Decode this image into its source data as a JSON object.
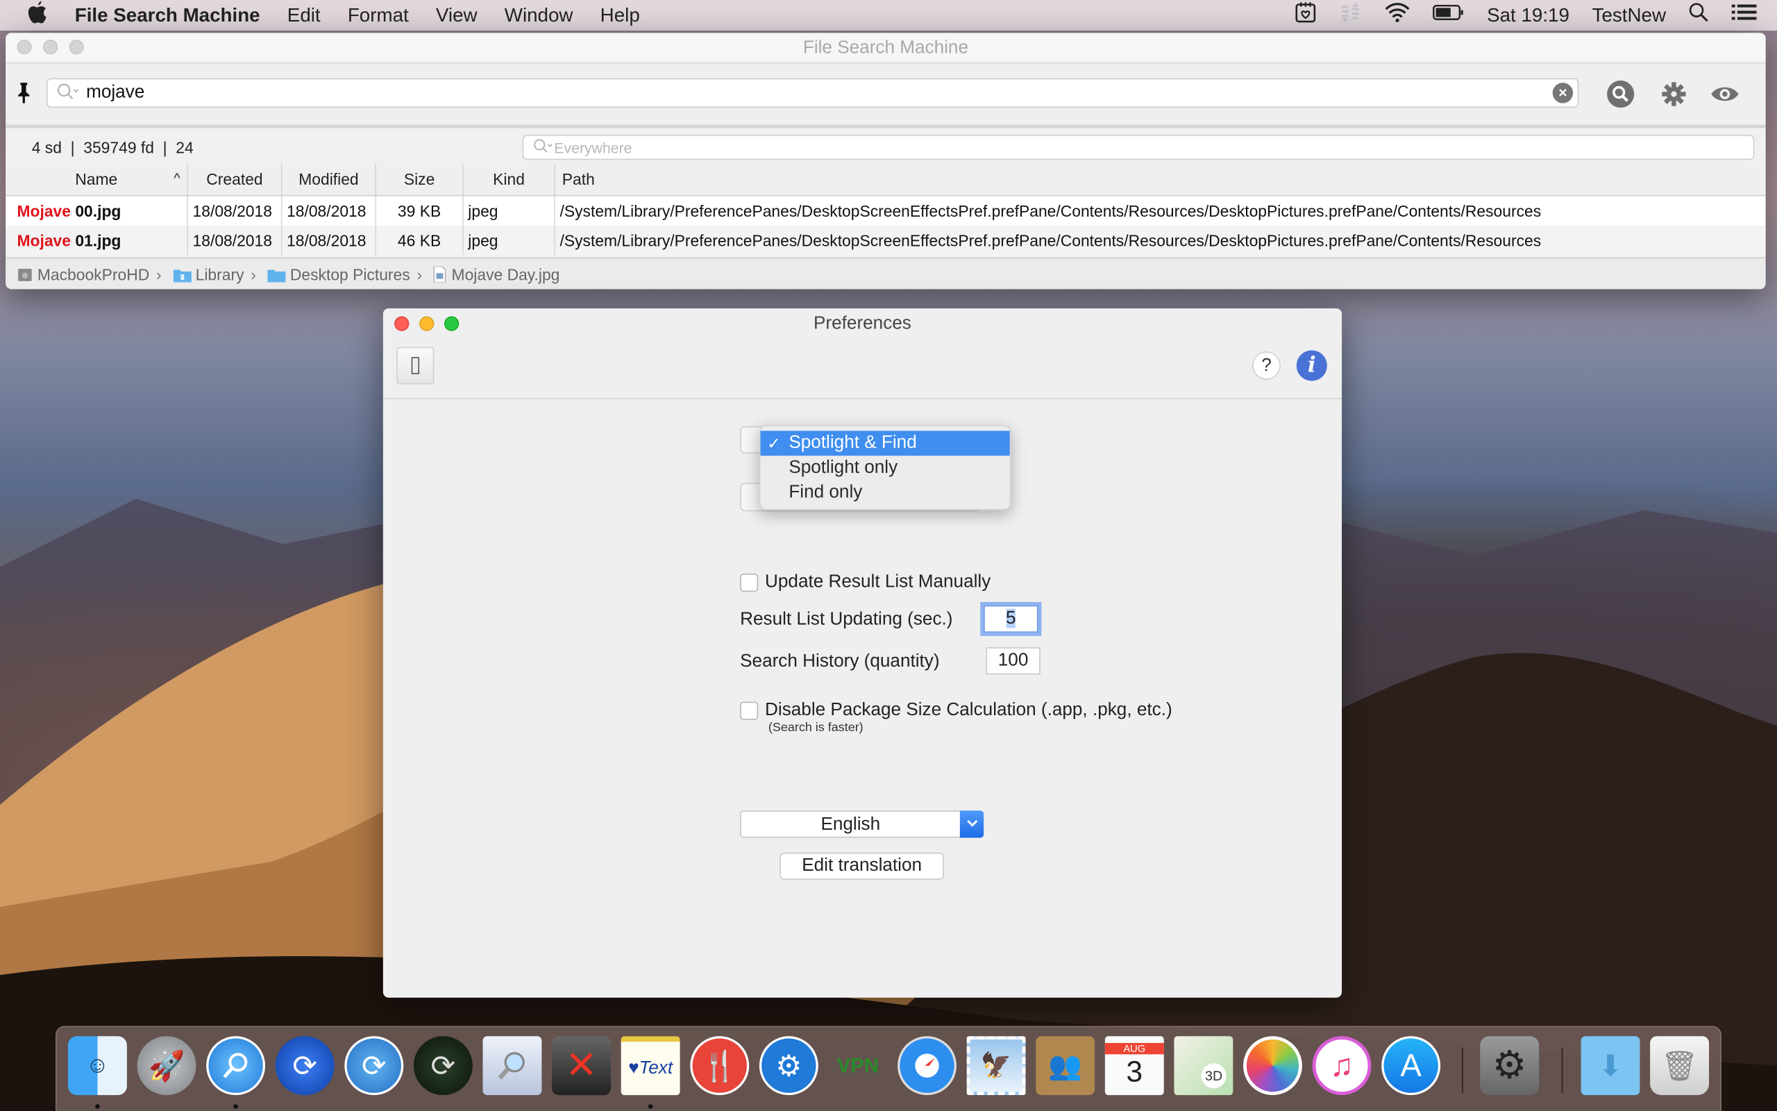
{
  "menubar": {
    "app_name": "File Search Machine",
    "menus": [
      "Edit",
      "Format",
      "View",
      "Window",
      "Help"
    ],
    "clock": "Sat 19:19",
    "user": "TestNew",
    "status_icons": [
      "calendar-heart-icon",
      "sync-arrows-icon",
      "wifi-icon",
      "battery-icon",
      "spotlight-icon",
      "notification-center-icon"
    ]
  },
  "main_window": {
    "title": "File Search Machine",
    "search": {
      "value": "mojave",
      "placeholder": ""
    },
    "stats": "4 sd  |  359749 fd  |  24",
    "scope": {
      "placeholder": "Everywhere"
    },
    "columns": [
      "Name",
      "Created",
      "Modified",
      "Size",
      "Kind",
      "Path"
    ],
    "sort": {
      "column": "Name",
      "direction": "ascending",
      "indicator": "^"
    },
    "rows": [
      {
        "name_highlight": "Mojave",
        "name_rest": " 00.jpg",
        "created": "18/08/2018",
        "modified": "18/08/2018",
        "size": "39 KB",
        "kind": "jpeg",
        "path": "/System/Library/PreferencePanes/DesktopScreenEffectsPref.prefPane/Contents/Resources/DesktopPictures.prefPane/Contents/Resources"
      },
      {
        "name_highlight": "Mojave",
        "name_rest": " 01.jpg",
        "created": "18/08/2018",
        "modified": "18/08/2018",
        "size": "46 KB",
        "kind": "jpeg",
        "path": "/System/Library/PreferencePanes/DesktopScreenEffectsPref.prefPane/Contents/Resources/DesktopPictures.prefPane/Contents/Resources"
      }
    ],
    "breadcrumb": [
      "MacbookProHD",
      "Library",
      "Desktop Pictures",
      "Mojave Day.jpg"
    ],
    "highlight_color": "#e0141e"
  },
  "preferences": {
    "title": "Preferences",
    "help_label": "?",
    "info_label": "i",
    "search_mode": {
      "options": [
        "Spotlight & Find",
        "Spotlight only",
        "Find only"
      ],
      "selected": "Spotlight & Find",
      "check": "✓"
    },
    "update_manually": {
      "label": "Update Result List Manually",
      "checked": false
    },
    "update_interval": {
      "label": "Result List Updating (sec.)",
      "value": "5"
    },
    "search_history": {
      "label": "Search History (quantity)",
      "value": "100"
    },
    "disable_package": {
      "label": "Disable Package Size Calculation (.app, .pkg, etc.)",
      "hint": "(Search is faster)",
      "checked": false
    },
    "language": {
      "value": "English"
    },
    "edit_translation_label": "Edit translation",
    "accent_color": "#3f8ef0"
  },
  "dock": {
    "apps": [
      "Finder",
      "Launchpad",
      "File Search Machine",
      "Sync",
      "Sync 2",
      "Binary Sync",
      "Preview Search",
      "Trash Remover",
      "Text",
      "Food",
      "System Toolkit",
      "VPN",
      "Safari",
      "Mail",
      "Contacts",
      "Calendar",
      "Maps",
      "Photos",
      "iTunes",
      "App Store",
      "System Preferences",
      "Downloads",
      "Trash"
    ],
    "calendar_month": "AUG",
    "calendar_day": "3"
  }
}
